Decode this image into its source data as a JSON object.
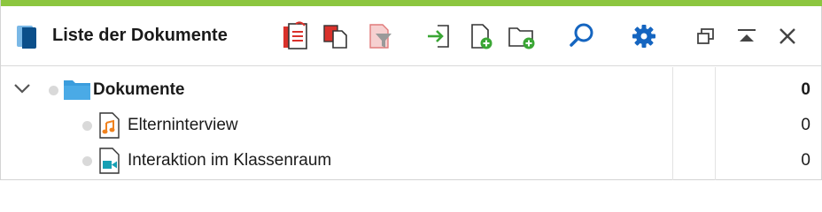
{
  "window": {
    "title": "Liste der Dokumente",
    "accent_color": "#8cc63f"
  },
  "toolbar": {
    "buttons": [
      {
        "name": "document-list-icon"
      },
      {
        "name": "copy-documents-icon"
      },
      {
        "name": "filter-icon"
      },
      {
        "name": "import-icon"
      },
      {
        "name": "new-document-icon"
      },
      {
        "name": "new-folder-icon"
      },
      {
        "name": "search-icon"
      },
      {
        "name": "settings-gear-icon"
      },
      {
        "name": "undock-window-icon"
      },
      {
        "name": "collapse-icon"
      },
      {
        "name": "close-icon"
      }
    ]
  },
  "tree": {
    "root": {
      "label": "Dokumente",
      "count": "0",
      "expanded": true
    },
    "children": [
      {
        "label": "Elterninterview",
        "count": "0",
        "type": "audio"
      },
      {
        "label": "Interaktion im Klassenraum",
        "count": "0",
        "type": "video"
      }
    ]
  },
  "colors": {
    "folder_blue": "#3b9ddd",
    "icon_red": "#d9312b",
    "icon_green": "#3aa635",
    "icon_blue": "#1565c0",
    "audio_orange": "#f0821e",
    "video_teal": "#16a0b4"
  }
}
